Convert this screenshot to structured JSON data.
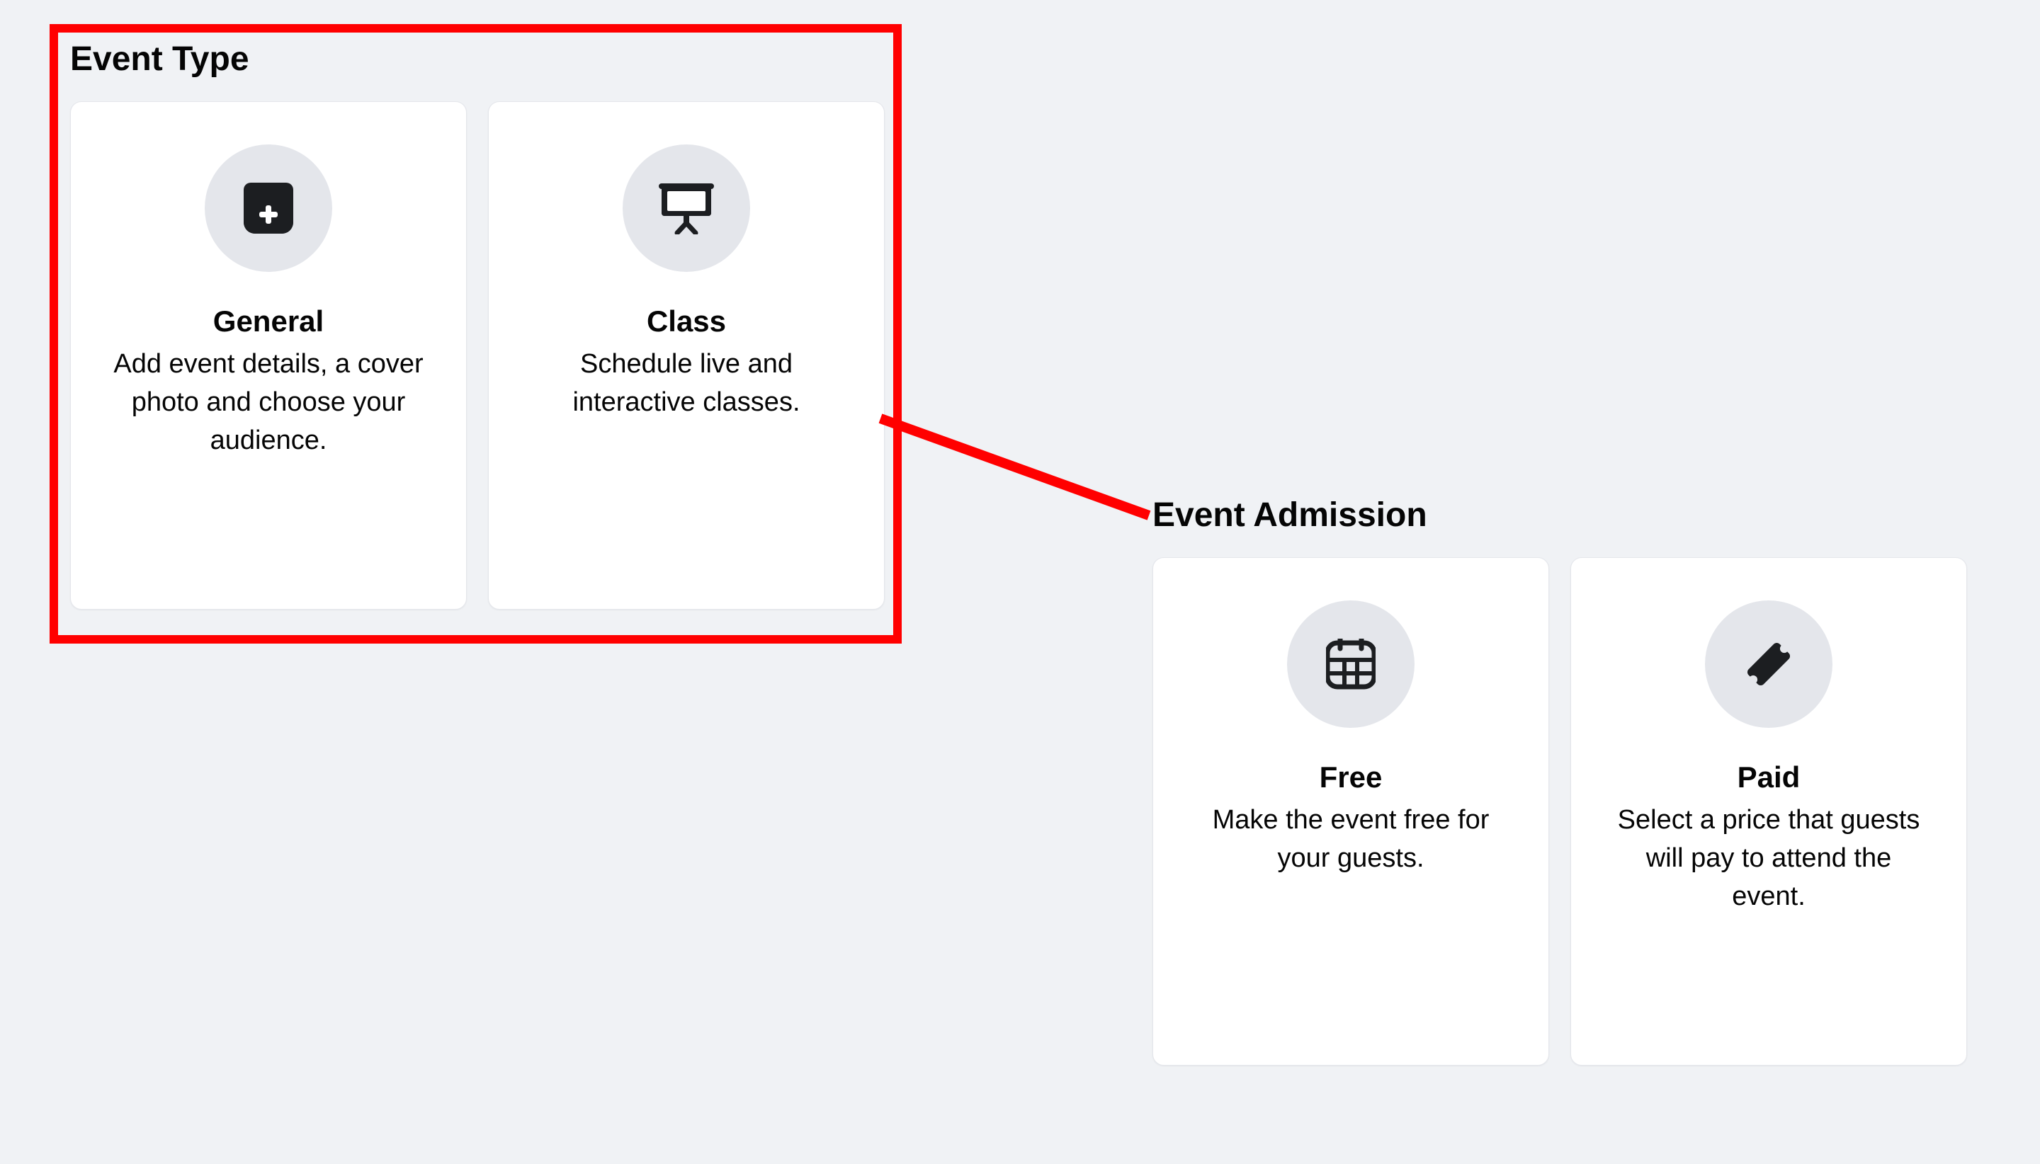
{
  "colors": {
    "highlight": "#ff0000",
    "card_bg": "#ffffff",
    "page_bg": "#f0f2f5",
    "icon_bubble": "#e4e6eb",
    "icon_fill": "#1c1e21"
  },
  "annotations": {
    "highlight_box_around": "event-type-section",
    "connector_from": "event-type-section",
    "connector_to": "event-admission-section"
  },
  "sections": {
    "event_type": {
      "title": "Event Type",
      "cards": {
        "general": {
          "title": "General",
          "description": "Add event details, a cover photo and choose your audience.",
          "icon": "calendar-add-icon"
        },
        "class": {
          "title": "Class",
          "description": "Schedule live and interactive classes.",
          "icon": "presentation-screen-icon"
        }
      }
    },
    "event_admission": {
      "title": "Event Admission",
      "cards": {
        "free": {
          "title": "Free",
          "description": "Make the event free for your guests.",
          "icon": "calendar-grid-icon"
        },
        "paid": {
          "title": "Paid",
          "description": "Select a price that guests will pay to attend the event.",
          "icon": "ticket-icon"
        }
      }
    }
  }
}
